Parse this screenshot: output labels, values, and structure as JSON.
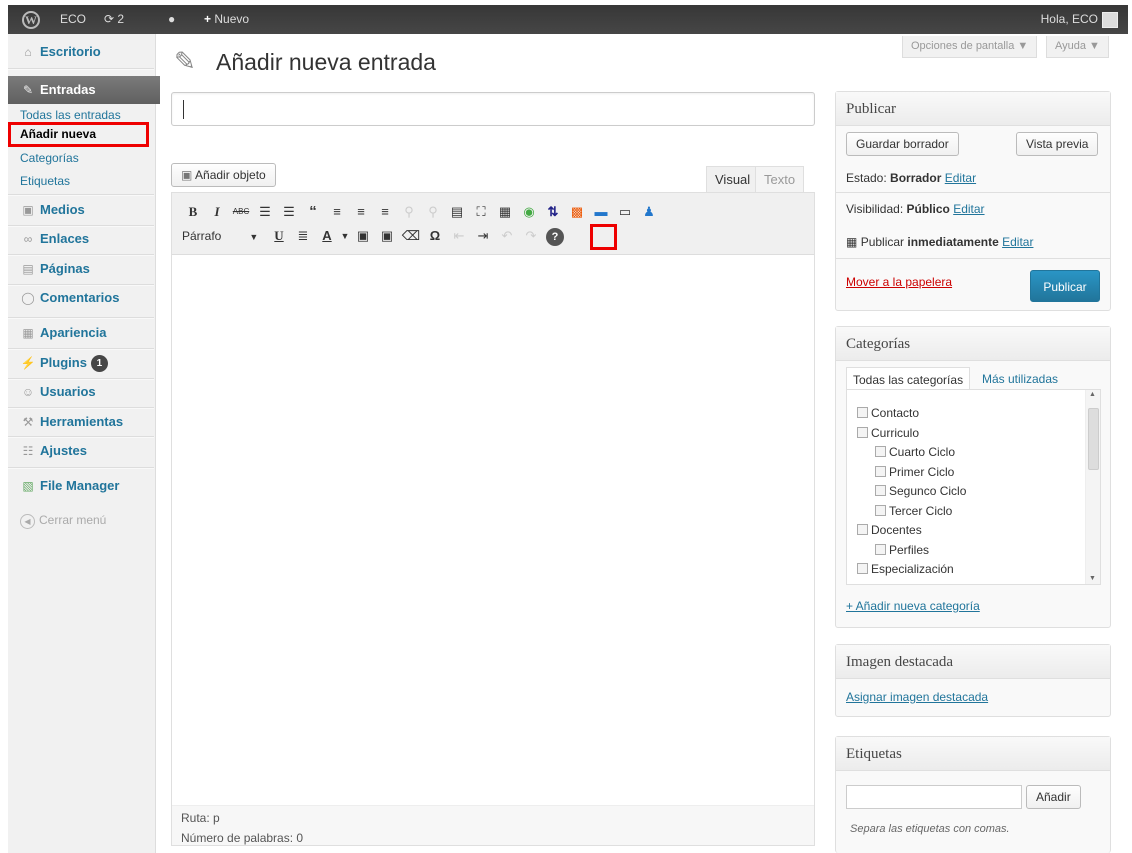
{
  "adminbar": {
    "site_name": "ECO",
    "updates_count": "2",
    "new_label": "Nuevo",
    "greeting": "Hola, ECO"
  },
  "sidebar": {
    "items": [
      {
        "label": "Escritorio",
        "icon": "home-icon"
      },
      {
        "label": "Entradas",
        "icon": "pin-icon"
      },
      {
        "label": "Medios",
        "icon": "media-icon"
      },
      {
        "label": "Enlaces",
        "icon": "links-icon"
      },
      {
        "label": "Páginas",
        "icon": "pages-icon"
      },
      {
        "label": "Comentarios",
        "icon": "comments-icon"
      },
      {
        "label": "Apariencia",
        "icon": "appearance-icon"
      },
      {
        "label": "Plugins",
        "icon": "plugins-icon",
        "badge": "1"
      },
      {
        "label": "Usuarios",
        "icon": "users-icon"
      },
      {
        "label": "Herramientas",
        "icon": "tools-icon"
      },
      {
        "label": "Ajustes",
        "icon": "settings-icon"
      },
      {
        "label": "File Manager",
        "icon": "file-manager-icon"
      }
    ],
    "submenu": [
      "Todas las entradas",
      "Añadir nueva",
      "Categorías",
      "Etiquetas"
    ],
    "collapse_label": "Cerrar menú"
  },
  "screen_options": "Opciones de pantalla",
  "help": "Ayuda",
  "page_title": "Añadir nueva entrada",
  "title_input_value": "",
  "editor": {
    "add_media": "Añadir objeto",
    "tab_visual": "Visual",
    "tab_text": "Texto",
    "format_select": "Párrafo",
    "path": "Ruta: p",
    "word_count": "Número de palabras: 0"
  },
  "publish": {
    "heading": "Publicar",
    "save_draft": "Guardar borrador",
    "preview": "Vista previa",
    "status_label": "Estado:",
    "status_value": "Borrador",
    "visibility_label": "Visibilidad:",
    "visibility_value": "Público",
    "publish_label": "Publicar",
    "publish_when": "inmediatamente",
    "edit": "Editar",
    "trash": "Mover a la papelera",
    "publish_button": "Publicar"
  },
  "categories": {
    "heading": "Categorías",
    "tab_all": "Todas las categorías",
    "tab_most": "Más utilizadas",
    "items": [
      {
        "label": "Contacto",
        "level": 0
      },
      {
        "label": "Curriculo",
        "level": 0
      },
      {
        "label": "Cuarto Ciclo",
        "level": 1
      },
      {
        "label": "Primer Ciclo",
        "level": 1
      },
      {
        "label": "Segunco Ciclo",
        "level": 1
      },
      {
        "label": "Tercer Ciclo",
        "level": 1
      },
      {
        "label": "Docentes",
        "level": 0
      },
      {
        "label": "Perfiles",
        "level": 1
      },
      {
        "label": "Especialización",
        "level": 0
      }
    ],
    "add_new": "+ Añadir nueva categoría"
  },
  "featured_image": {
    "heading": "Imagen destacada",
    "link": "Asignar imagen destacada"
  },
  "tags": {
    "heading": "Etiquetas",
    "add_button": "Añadir",
    "hint": "Separa las etiquetas con comas."
  }
}
